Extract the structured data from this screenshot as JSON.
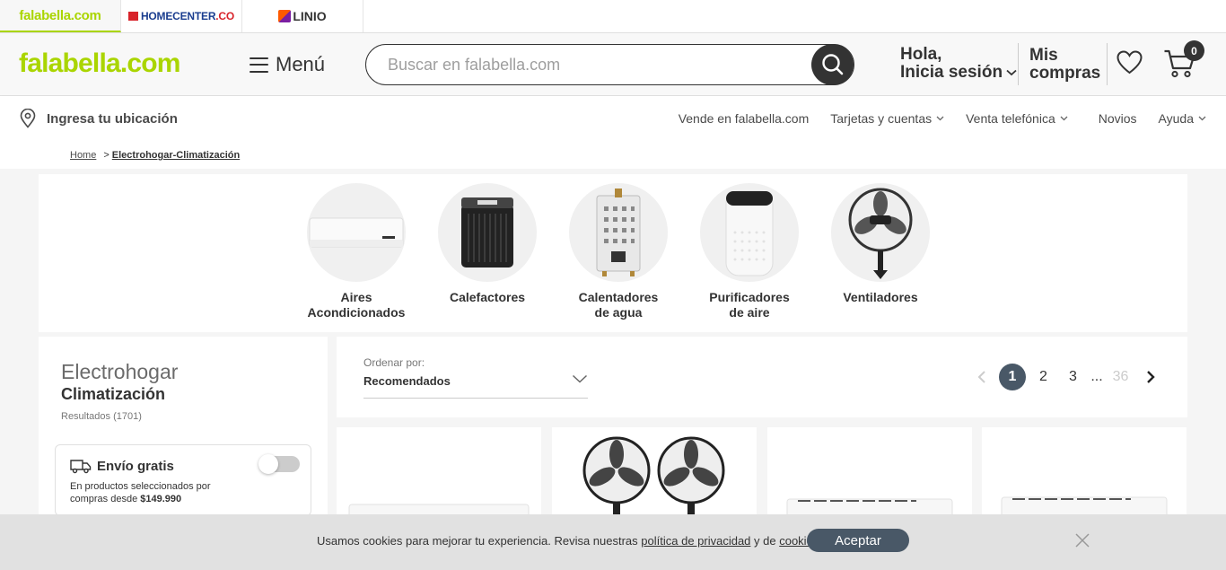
{
  "brand_tabs": [
    {
      "label": "falabella.com"
    },
    {
      "label_main": "HOMECENTER",
      "label_suffix": ".CO"
    },
    {
      "label": "LINIO"
    }
  ],
  "header": {
    "logo": "falabella.com",
    "menu_label": "Menú",
    "search_placeholder": "Buscar en falabella.com",
    "login_line1": "Hola,",
    "login_line2": "Inicia sesión",
    "purchases_line1": "Mis",
    "purchases_line2": "compras",
    "cart_count": "0"
  },
  "location_bar": {
    "location_label": "Ingresa tu ubicación",
    "links": [
      {
        "label": "Vende en falabella.com",
        "dropdown": false
      },
      {
        "label": "Tarjetas y cuentas",
        "dropdown": true
      },
      {
        "label": "Venta telefónica",
        "dropdown": true
      },
      {
        "label": "Novios",
        "dropdown": false
      },
      {
        "label": "Ayuda",
        "dropdown": true
      }
    ]
  },
  "breadcrumb": {
    "home": "Home",
    "separator": ">",
    "current": "Electrohogar-Climatización"
  },
  "categories": [
    {
      "line1": "Aires",
      "line2": "Acondicionados",
      "icon": "air-conditioner-icon"
    },
    {
      "line1": "Calefactores",
      "line2": "",
      "icon": "heater-icon"
    },
    {
      "line1": "Calentadores",
      "line2": "de agua",
      "icon": "water-heater-icon"
    },
    {
      "line1": "Purificadores",
      "line2": "de aire",
      "icon": "air-purifier-icon"
    },
    {
      "line1": "Ventiladores",
      "line2": "",
      "icon": "fan-icon"
    }
  ],
  "sidebar": {
    "category": "Electrohogar",
    "subcategory": "Climatización",
    "results": "Resultados (1701)",
    "free_shipping": {
      "title": "Envío gratis",
      "desc_prefix": "En productos seleccionados por compras desde ",
      "desc_amount": "$149.990",
      "toggle_on": false
    }
  },
  "sort": {
    "label": "Ordenar por:",
    "value": "Recomendados"
  },
  "pagination": {
    "pages": [
      "1",
      "2",
      "3"
    ],
    "ellipsis": "...",
    "last": "36",
    "current": "1"
  },
  "cookie_banner": {
    "text_prefix": "Usamos cookies para mejorar tu experiencia. Revisa nuestras ",
    "privacy_link": "política de privacidad",
    "text_middle": " y de ",
    "cookies_link": "cookies",
    "text_suffix": ".",
    "accept_label": "Aceptar"
  },
  "colors": {
    "brand_green": "#aad500",
    "dark": "#333333",
    "accent_slate": "#495867"
  }
}
